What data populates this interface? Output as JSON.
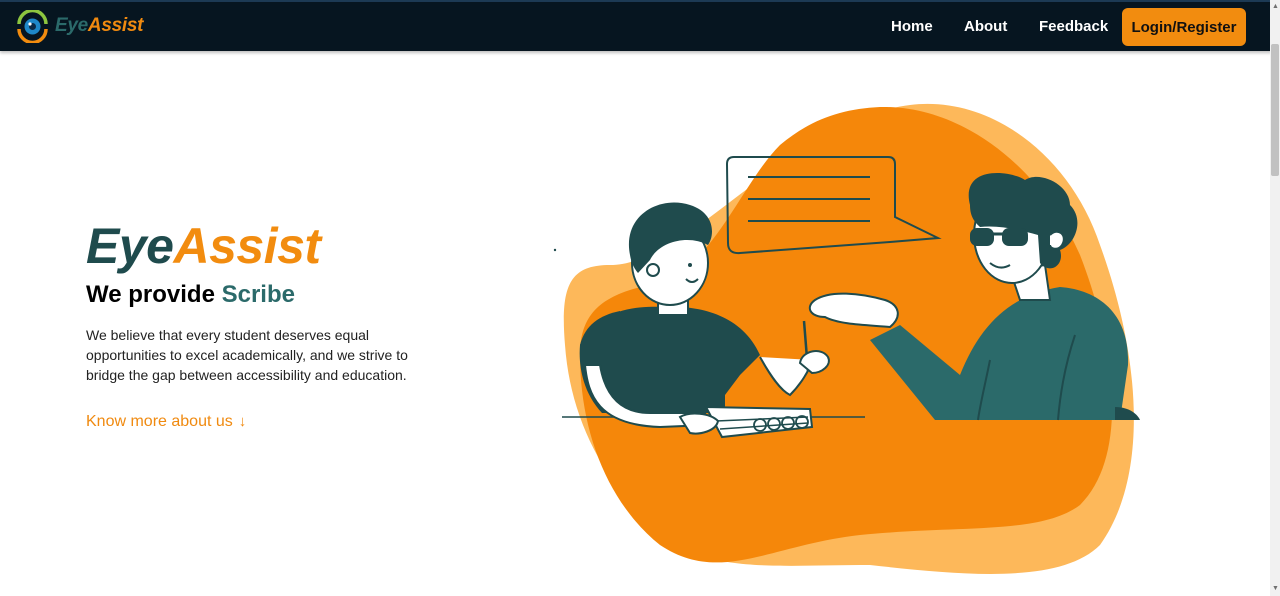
{
  "brand": {
    "name_part1": "Eye",
    "name_part2": "Assist",
    "logo_icon": "eye-logo-icon"
  },
  "nav": {
    "home_label": "Home",
    "about_label": "About",
    "feedback_label": "Feedback",
    "login_label": "Login/Register"
  },
  "hero": {
    "title_part1": "Eye",
    "title_part2": "Assist",
    "subtitle_prefix": "We provide ",
    "subtitle_accent": "Scribe",
    "description": "We believe that every student deserves equal opportunities to excel academically, and we strive to bridge the gap between accessibility and education.",
    "cta_label": "Know more about us",
    "cta_icon": "arrow-down-icon"
  },
  "colors": {
    "nav_bg": "#061520",
    "accent_orange": "#f28c0f",
    "teal": "#2b6a6a",
    "dark_teal": "#1f4b4d",
    "light_orange": "#fdb85a"
  }
}
